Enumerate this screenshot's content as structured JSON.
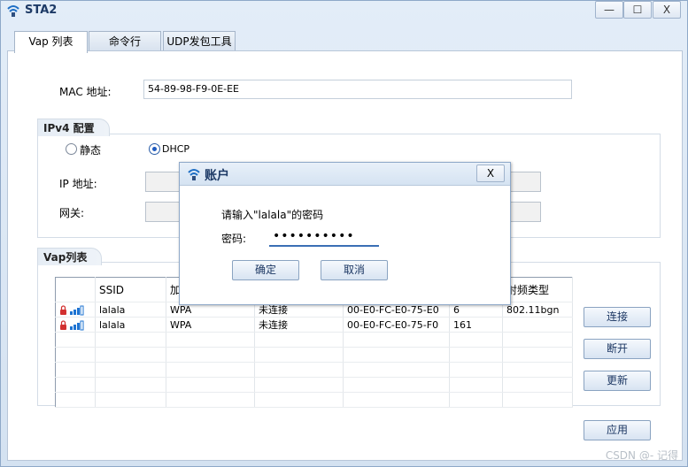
{
  "window": {
    "title": "STA2",
    "minimize": "—",
    "maximize": "☐",
    "close": "X"
  },
  "tabs": [
    {
      "label": "Vap 列表",
      "active": true
    },
    {
      "label": "命令行",
      "active": false
    },
    {
      "label": "UDP发包工具",
      "active": false
    }
  ],
  "mac": {
    "label": "MAC 地址:",
    "value": "54-89-98-F9-0E-EE"
  },
  "ipv4": {
    "group_title": "IPv4 配置",
    "static_label": "静态",
    "dhcp_label": "DHCP",
    "selected": "DHCP",
    "ip_label": "IP 地址:",
    "gateway_label": "网关:"
  },
  "vap": {
    "group_title": "Vap列表",
    "columns": [
      "",
      "SSID",
      "加",
      "",
      "",
      "",
      "射频类型"
    ],
    "rows": [
      {
        "ssid": "lalala",
        "security": "WPA",
        "status": "未连接",
        "mac": "00-E0-FC-E0-75-E0",
        "channel": "6",
        "radio": "802.11bgn"
      },
      {
        "ssid": "lalala",
        "security": "WPA",
        "status": "未连接",
        "mac": "00-E0-FC-E0-75-F0",
        "channel": "161",
        "radio": ""
      }
    ],
    "buttons": {
      "connect": "连接",
      "disconnect": "断开",
      "refresh": "更新"
    }
  },
  "apply_button": "应用",
  "dialog": {
    "title": "账户",
    "close": "X",
    "prompt": "请输入\"lalala\"的密码",
    "password_label": "密码:",
    "password_value": "••••••••••",
    "ok": "确定",
    "cancel": "取消"
  },
  "watermark": "CSDN @- 记得",
  "colors": {
    "accent": "#1f5bc0",
    "title_text": "#1d3a66",
    "lock": "#d23030",
    "signal": "#1e73d2"
  }
}
